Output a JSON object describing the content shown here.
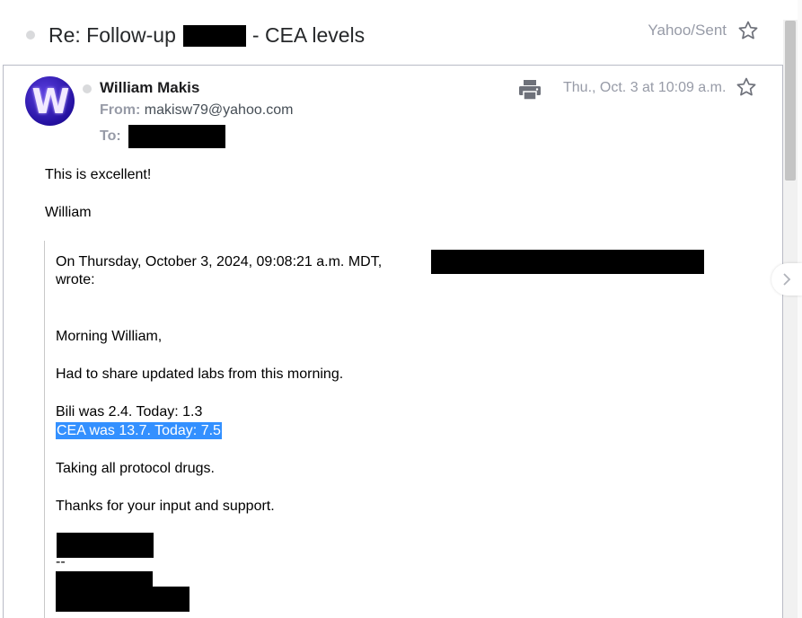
{
  "thread": {
    "subject_prefix": "Re: Follow-up",
    "subject_suffix": "- CEA levels",
    "folder": "Yahoo/Sent"
  },
  "message": {
    "avatar_letter": "W",
    "sender_name": "William Makis",
    "from_label": "From:",
    "from_address": "makisw79@yahoo.com",
    "to_label": "To:",
    "date": "Thu., Oct. 3 at 10:09 a.m."
  },
  "body": {
    "line1": "This is excellent!",
    "line2": "William"
  },
  "quote": {
    "header_line1": "On Thursday, October 3, 2024, 09:08:21 a.m. MDT,",
    "header_line2": "wrote:",
    "greeting": "Morning William,",
    "p1": "Had to share updated labs from this morning.",
    "bili": "Bili was 2.4.  Today: 1.3",
    "cea": "CEA was 13.7. Today: 7.5",
    "p3": "Taking all protocol drugs.",
    "p4": "Thanks for your input and support.",
    "sig_sep": "--"
  },
  "icons": {
    "thread_star": "star-outline-icon",
    "print": "print-icon",
    "message_star": "star-outline-icon",
    "next": "chevron-right-icon"
  },
  "colors": {
    "highlight": "#3390ff",
    "muted": "#979ba7",
    "redaction": "#000000"
  }
}
